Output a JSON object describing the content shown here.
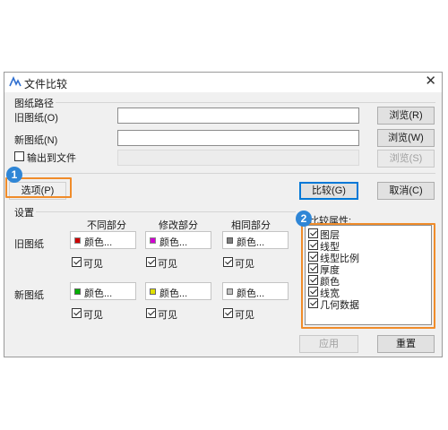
{
  "window": {
    "title": "文件比较",
    "app_icon": "app-logo-icon",
    "close_icon": "close-icon"
  },
  "paths": {
    "group_label": "图纸路径",
    "old_label": "旧图纸(O)",
    "old_value": "",
    "old_browse": "浏览(R)",
    "new_label": "新图纸(N)",
    "new_value": "",
    "new_browse": "浏览(W)",
    "output_label": "输出到文件",
    "output_checked": false,
    "output_value": "",
    "output_browse": "浏览(S)"
  },
  "actions": {
    "options": "选项(P)",
    "compare": "比较(G)",
    "cancel": "取消(C)",
    "apply": "应用",
    "reset": "重置"
  },
  "settings": {
    "group_label": "设置",
    "columns": [
      "不同部分",
      "修改部分",
      "相同部分"
    ],
    "old_row_label": "旧图纸",
    "new_row_label": "新图纸",
    "color_text": "颜色...",
    "visible_label": "可见",
    "old_colors": [
      "#cc0000",
      "#d000d0",
      "#808080"
    ],
    "new_colors": [
      "#00b000",
      "#e0e000",
      "#c0c0c0"
    ],
    "old_visible": [
      true,
      true,
      true
    ],
    "new_visible": [
      true,
      true,
      true
    ]
  },
  "attrs": {
    "label": "比较属性:",
    "items": [
      {
        "label": "图层",
        "checked": true
      },
      {
        "label": "线型",
        "checked": true
      },
      {
        "label": "线型比例",
        "checked": true
      },
      {
        "label": "厚度",
        "checked": true
      },
      {
        "label": "颜色",
        "checked": true
      },
      {
        "label": "线宽",
        "checked": true
      },
      {
        "label": "几何数据",
        "checked": true
      }
    ]
  },
  "annotations": {
    "badge1": "1",
    "badge2": "2",
    "highlight_color": "#f08c2a",
    "badge_color": "#2f86d6"
  }
}
